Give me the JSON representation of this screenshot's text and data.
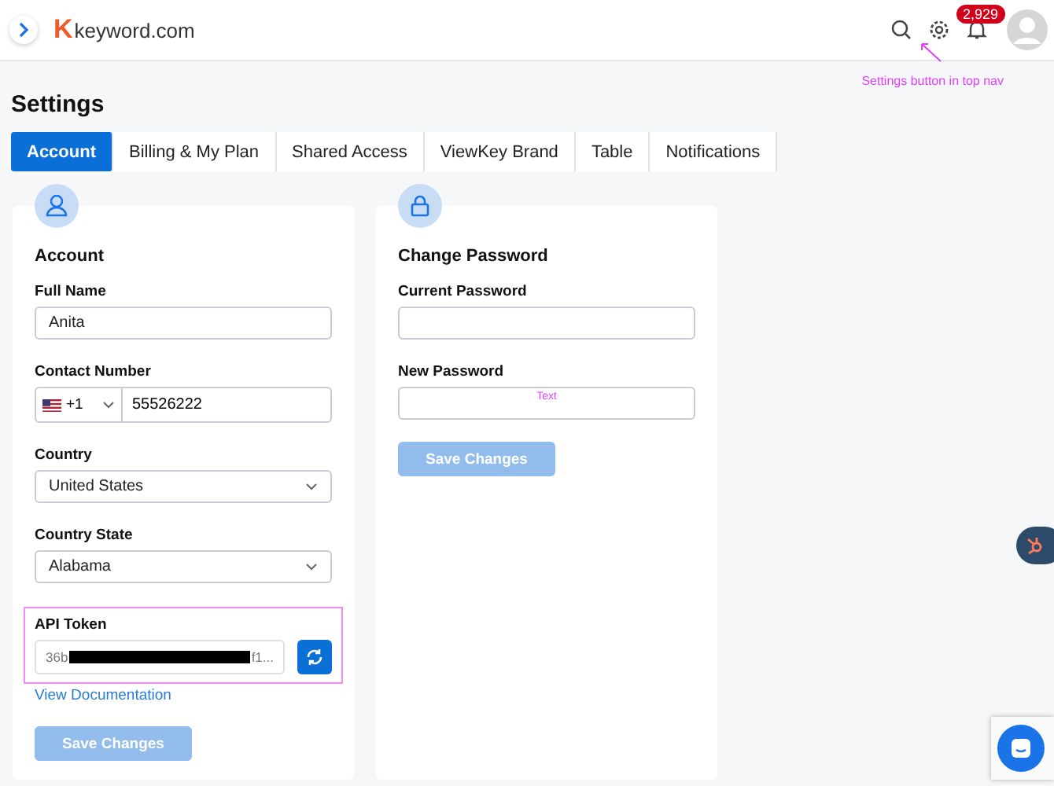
{
  "header": {
    "logo_letter": "K",
    "logo_text": "keyword.com",
    "notification_count": "2,929",
    "annotation": "Settings button in top nav"
  },
  "page_title": "Settings",
  "tabs": [
    {
      "label": "Account",
      "selected": true
    },
    {
      "label": "Billing & My Plan",
      "selected": false
    },
    {
      "label": "Shared Access",
      "selected": false
    },
    {
      "label": "ViewKey Brand",
      "selected": false
    },
    {
      "label": "Table",
      "selected": false
    },
    {
      "label": "Notifications",
      "selected": false
    }
  ],
  "account": {
    "title": "Account",
    "full_name": {
      "label": "Full Name",
      "value": "Anita"
    },
    "contact": {
      "label": "Contact Number",
      "code": "+1",
      "value": "55526222"
    },
    "country": {
      "label": "Country",
      "value": "United States"
    },
    "state": {
      "label": "Country State",
      "value": "Alabama"
    },
    "api_token": {
      "label": "API Token",
      "start": "36b",
      "end": "f1...",
      "highlighted": true
    },
    "docs_link": "View Documentation",
    "save": {
      "label": "Save Changes",
      "disabled": true
    }
  },
  "password": {
    "title": "Change Password",
    "current": {
      "label": "Current Password"
    },
    "new": {
      "label": "New Password",
      "annotation": "Text"
    },
    "save": {
      "label": "Save Changes",
      "disabled": true
    }
  }
}
